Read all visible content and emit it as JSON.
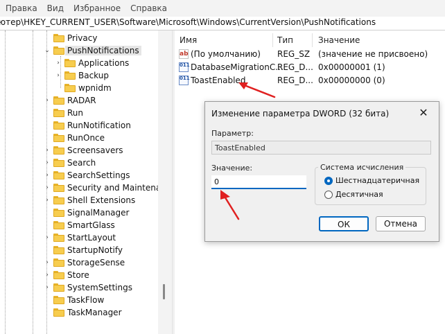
{
  "menubar": {
    "items": [
      "Правка",
      "Вид",
      "Избранное",
      "Справка"
    ]
  },
  "address": {
    "path": "ютер\\HKEY_CURRENT_USER\\Software\\Microsoft\\Windows\\CurrentVersion\\PushNotifications"
  },
  "tree": {
    "items": [
      {
        "label": "Privacy"
      },
      {
        "label": "PushNotifications"
      },
      {
        "label": "Applications"
      },
      {
        "label": "Backup"
      },
      {
        "label": "wpnidm"
      },
      {
        "label": "RADAR"
      },
      {
        "label": "Run"
      },
      {
        "label": "RunNotification"
      },
      {
        "label": "RunOnce"
      },
      {
        "label": "Screensavers"
      },
      {
        "label": "Search"
      },
      {
        "label": "SearchSettings"
      },
      {
        "label": "Security and Maintenanc"
      },
      {
        "label": "Shell Extensions"
      },
      {
        "label": "SignalManager"
      },
      {
        "label": "SmartGlass"
      },
      {
        "label": "StartLayout"
      },
      {
        "label": "StartupNotify"
      },
      {
        "label": "StorageSense"
      },
      {
        "label": "Store"
      },
      {
        "label": "SystemSettings"
      },
      {
        "label": "TaskFlow"
      },
      {
        "label": "TaskManager"
      }
    ]
  },
  "values_pane": {
    "headers": {
      "name": "Имя",
      "type": "Тип",
      "data": "Значение"
    },
    "rows": [
      {
        "icon": "ab",
        "name": "(По умолчанию)",
        "type": "REG_SZ",
        "data": "(значение не присвоено)"
      },
      {
        "icon": "011",
        "name": "DatabaseMigrationC...",
        "type": "REG_D...",
        "data": "0x00000001 (1)"
      },
      {
        "icon": "011",
        "name": "ToastEnabled",
        "type": "REG_D...",
        "data": "0x00000000 (0)"
      }
    ]
  },
  "dialog": {
    "title": "Изменение параметра DWORD (32 бита)",
    "param_label": "Параметр:",
    "param_value": "ToastEnabled",
    "value_label": "Значение:",
    "value": "0",
    "radix_label": "Система исчисления",
    "radix_hex": "Шестнадцатеричная",
    "radix_dec": "Десятичная",
    "ok": "ОК",
    "cancel": "Отмена",
    "close_glyph": "✕"
  },
  "colors": {
    "accent": "#0067c0",
    "arrow": "#e02020",
    "folder": "#f7cd4f"
  }
}
